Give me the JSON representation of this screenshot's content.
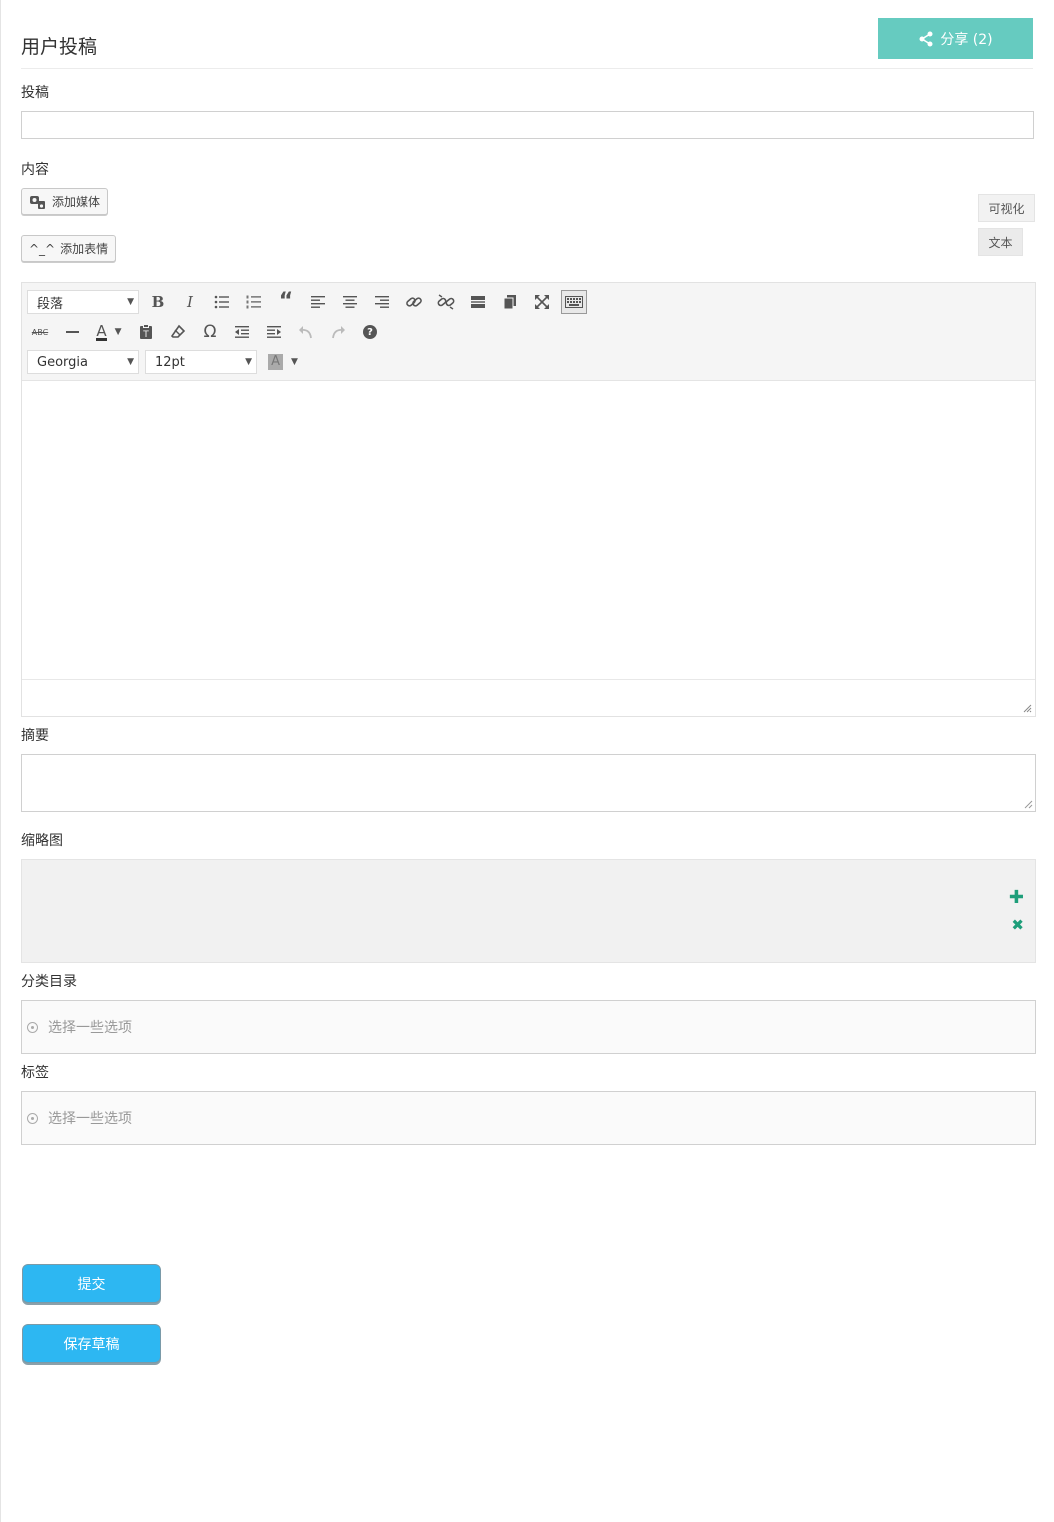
{
  "header": {
    "title": "用户投稿",
    "share_label": "分享 (2)"
  },
  "fields": {
    "post_label": "投稿",
    "post_value": "",
    "content_label": "内容",
    "add_media": "添加媒体",
    "add_emoji": "添加表情",
    "emoji_glyph": "^_^",
    "excerpt_label": "摘要",
    "thumbnail_label": "缩略图",
    "category_label": "分类目录",
    "category_placeholder": "选择一些选项",
    "tags_label": "标签",
    "tags_placeholder": "选择一些选项"
  },
  "editor": {
    "mode_visual": "可视化",
    "mode_text": "文本",
    "format_select": "段落",
    "font_select": "Georgia",
    "size_select": "12pt",
    "row1_icons": [
      "bold-icon",
      "italic-icon",
      "bullet-list-icon",
      "numbered-list-icon",
      "blockquote-icon",
      "align-left-icon",
      "align-center-icon",
      "align-right-icon",
      "link-icon",
      "unlink-icon",
      "read-more-icon",
      "copy-icon",
      "fullscreen-icon",
      "toolbar-toggle-icon"
    ],
    "row2_icons": [
      "strikethrough-icon",
      "horizontal-rule-icon",
      "text-color-icon",
      "paste-text-icon",
      "clear-format-icon",
      "special-char-icon",
      "outdent-icon",
      "indent-icon",
      "undo-icon",
      "redo-icon",
      "help-icon"
    ],
    "bold_glyph": "B",
    "italic_glyph": "I",
    "omega_glyph": "Ω",
    "text_color_glyph": "A",
    "bg_color_glyph": "A",
    "strike_glyph": "ABC",
    "help_glyph": "?"
  },
  "actions": {
    "submit": "提交",
    "save_draft": "保存草稿"
  },
  "colors": {
    "share_bg": "#66cbc0",
    "primary_btn": "#2db7f2",
    "thumb_action": "#1e9e7a"
  }
}
